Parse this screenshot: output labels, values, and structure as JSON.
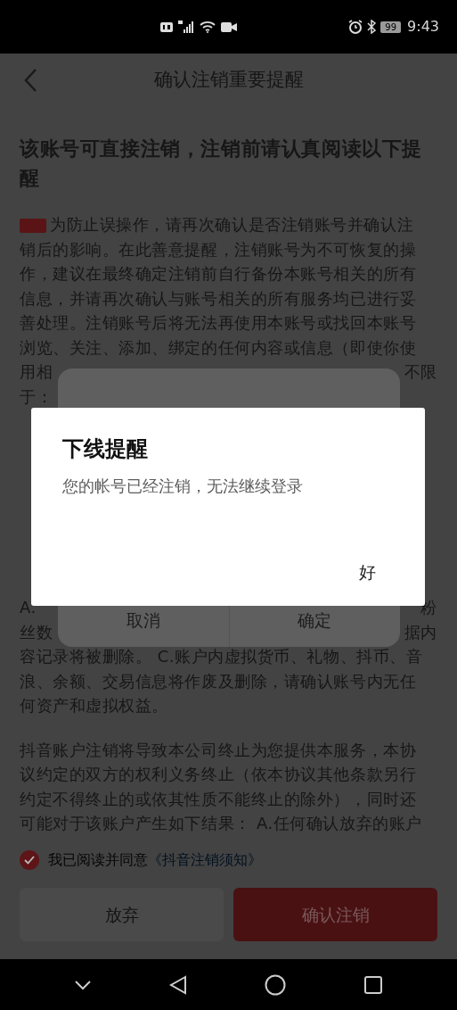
{
  "status_bar": {
    "battery": "99",
    "time": "9:43"
  },
  "header": {
    "title": "确认注销重要提醒"
  },
  "notice": {
    "heading": [
      "该账号可直接注销，注销前请认真阅读以下提",
      "醒"
    ],
    "paragraphs": [
      {
        "tagged": true,
        "lines": [
          {
            "kind": "full",
            "text": "为防止误操作，请再次确认是否注销账号并确认注"
          },
          {
            "kind": "full",
            "text": "销后的影响。在此善意提醒，注销账号为不可恢复的操"
          },
          {
            "kind": "full",
            "text": "作，建议在最终确定注销前自行备份本账号相关的所有"
          },
          {
            "kind": "full",
            "text": "信息，并请再次确认与账号相关的所有服务均已进行妥"
          },
          {
            "kind": "full",
            "text": "善处理。注销账号后将无法再使用本账号或找回本账号"
          },
          {
            "kind": "full",
            "text": "浏览、关注、添加、绑定的任何内容或信息（即使你使"
          },
          {
            "kind": "split",
            "start": "用相",
            "end": "不限"
          },
          {
            "kind": "split",
            "start": "于："
          }
        ]
      },
      {
        "tagged": false,
        "lines": [
          {
            "kind": "covered"
          },
          {
            "kind": "covered"
          },
          {
            "kind": "covered"
          },
          {
            "kind": "covered"
          },
          {
            "kind": "covered"
          }
        ]
      },
      {
        "tagged": false,
        "lines": [
          {
            "kind": "covered"
          },
          {
            "kind": "split",
            "start": "A.",
            "end": "粉"
          },
          {
            "kind": "split",
            "start": "丝数",
            "end": "据内"
          },
          {
            "kind": "full",
            "text": "容记录将被删除。 C.账户内虚拟货币、礼物、抖币、音"
          },
          {
            "kind": "full",
            "text": "浪、余额、交易信息将作废及删除，请确认账号内无任"
          },
          {
            "kind": "full",
            "text": "何资产和虚拟权益。"
          }
        ]
      },
      {
        "tagged": false,
        "lines": [
          {
            "kind": "full",
            "text": "抖音账户注销将导致本公司终止为您提供本服务，本协"
          },
          {
            "kind": "full",
            "text": "议约定的双方的权利义务终止（依本协议其他条款另行"
          },
          {
            "kind": "full",
            "text": "约定不得终止的或依其性质不能终止的除外），同时还"
          },
          {
            "kind": "full",
            "text": "可能对于该账户产生如下结果： A.任何确认放弃的账户"
          }
        ]
      }
    ]
  },
  "agreement": {
    "checked": true,
    "text": "我已阅读并同意",
    "link": "《抖音注销须知》"
  },
  "actions": [
    {
      "kind": "secondary",
      "label": "放弃"
    },
    {
      "kind": "primary",
      "label": "确认注销"
    }
  ],
  "confirm_dialog": {
    "buttons": [
      "取消",
      "确定"
    ]
  },
  "offline_dialog": {
    "title": "下线提醒",
    "message": "您的帐号已经注销，无法继续登录",
    "button": "好"
  }
}
